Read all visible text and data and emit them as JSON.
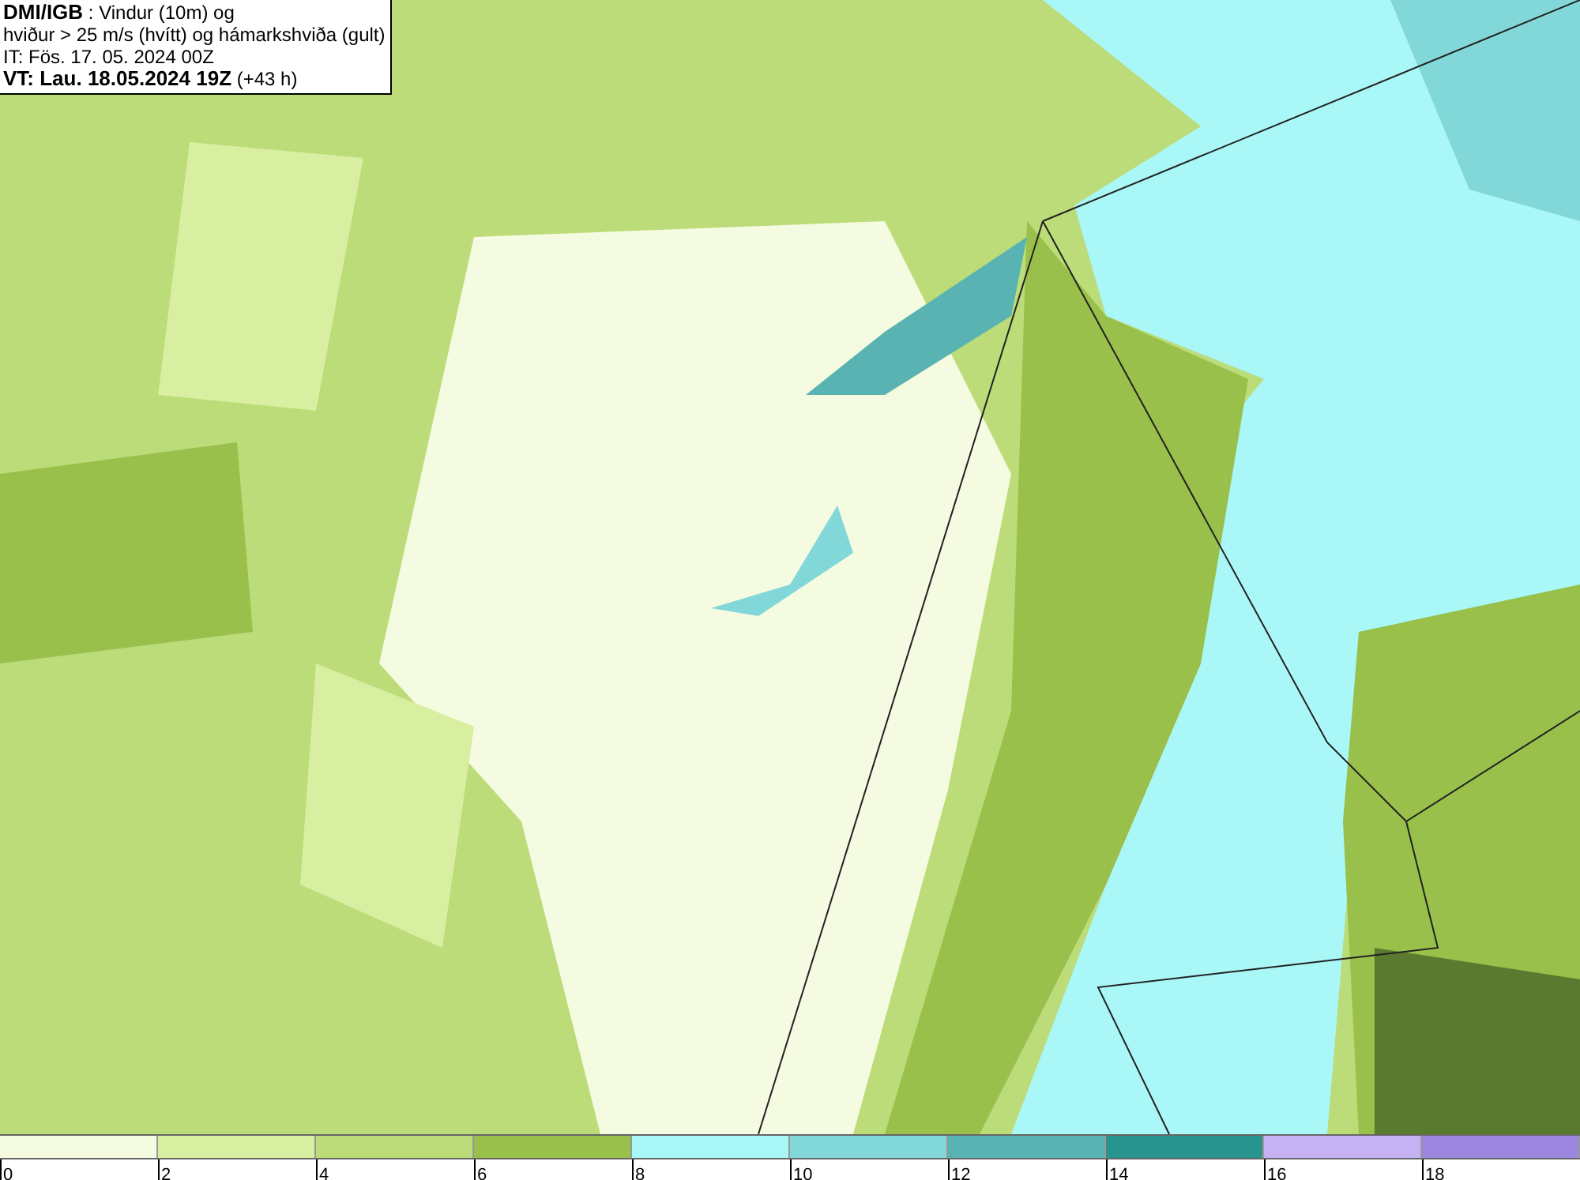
{
  "header": {
    "lines": [
      "**DMI/IGB** : Vindur (10m) og",
      "hviður > 25 m/s (hvítt) og hámarkshviða (gult)",
      "IT: Fös. 17. 05. 2024 00Z",
      "**VT: Lau. 18.05.2024 19Z** (+43 h)"
    ]
  },
  "legend": {
    "bands": [
      {
        "color": "#f5fbe0",
        "label": "0"
      },
      {
        "color": "#d8eea0",
        "label": "2"
      },
      {
        "color": "#bbdc78",
        "label": "4"
      },
      {
        "color": "#98c04a",
        "label": "6"
      },
      {
        "color": "#aaf7f7",
        "label": "8"
      },
      {
        "color": "#82d8d8",
        "label": "10"
      },
      {
        "color": "#5ab3b3",
        "label": "12"
      },
      {
        "color": "#289490",
        "label": "14"
      },
      {
        "color": "#c4b2f2",
        "label": "16"
      },
      {
        "color": "#9c86e0",
        "label": "18"
      }
    ]
  }
}
